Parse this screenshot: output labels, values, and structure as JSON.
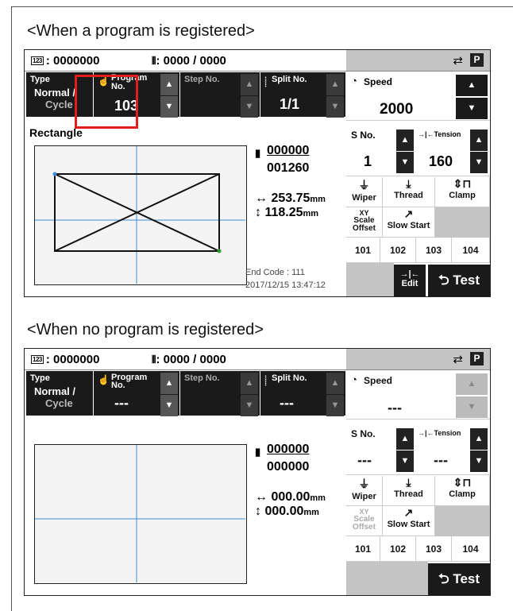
{
  "captions": {
    "registered": "<When a program is registered>",
    "not_registered": "<When no program is registered>"
  },
  "screen1": {
    "counter": ": 0000000",
    "stitch": ": 0000 / 0000",
    "counter_icon": "123",
    "type_label": "Type",
    "type_value_1": "Normal /",
    "type_value_2": "Cycle",
    "program_label_1": "Program",
    "program_label_2": "No.",
    "program_value": "103",
    "step_label": "Step No.",
    "split_label": "Split No.",
    "split_value": "1/1",
    "speed_label": "Speed",
    "speed_value": "2000",
    "s_no_label": "No.",
    "s_no_value": "1",
    "tension_label": "Tension",
    "tension_value": "160",
    "pattern_name": "Rectangle",
    "stitch_top": "000000",
    "stitch_bottom": "001260",
    "size_x": "253.75",
    "size_y": "118.25",
    "unit": "mm",
    "wiper": "Wiper",
    "thread": "Thread",
    "clamp": "Clamp",
    "scale_1": "Scale",
    "scale_2": "Offset",
    "slow_start": "Slow Start",
    "buttons": [
      "101",
      "102",
      "103",
      "104"
    ],
    "end_code": "End Code : 111",
    "datetime": "2017/12/15 13:47:12",
    "edit": "Edit",
    "test": "Test"
  },
  "screen2": {
    "counter": ": 0000000",
    "stitch": ": 0000 / 0000",
    "type_label": "Type",
    "type_value_1": "Normal /",
    "type_value_2": "Cycle",
    "program_label_1": "Program",
    "program_label_2": "No.",
    "program_value": "---",
    "step_label": "Step No.",
    "split_label": "Split No.",
    "split_value": "---",
    "speed_label": "Speed",
    "speed_value": "---",
    "s_no_label": "No.",
    "s_no_value": "---",
    "tension_label": "Tension",
    "tension_value": "---",
    "stitch_top": "000000",
    "stitch_bottom": "000000",
    "size_x": "000.00",
    "size_y": "000.00",
    "unit": "mm",
    "wiper": "Wiper",
    "thread": "Thread",
    "clamp": "Clamp",
    "scale_1": "Scale",
    "scale_2": "Offset",
    "slow_start": "Slow Start",
    "buttons": [
      "101",
      "102",
      "103",
      "104"
    ],
    "test": "Test"
  },
  "colors": {
    "highlight": "#e01e1e",
    "panel_dark": "#1a1a1a",
    "panel_gray": "#c4c4c4",
    "guide_line": "#3b8fd6"
  }
}
